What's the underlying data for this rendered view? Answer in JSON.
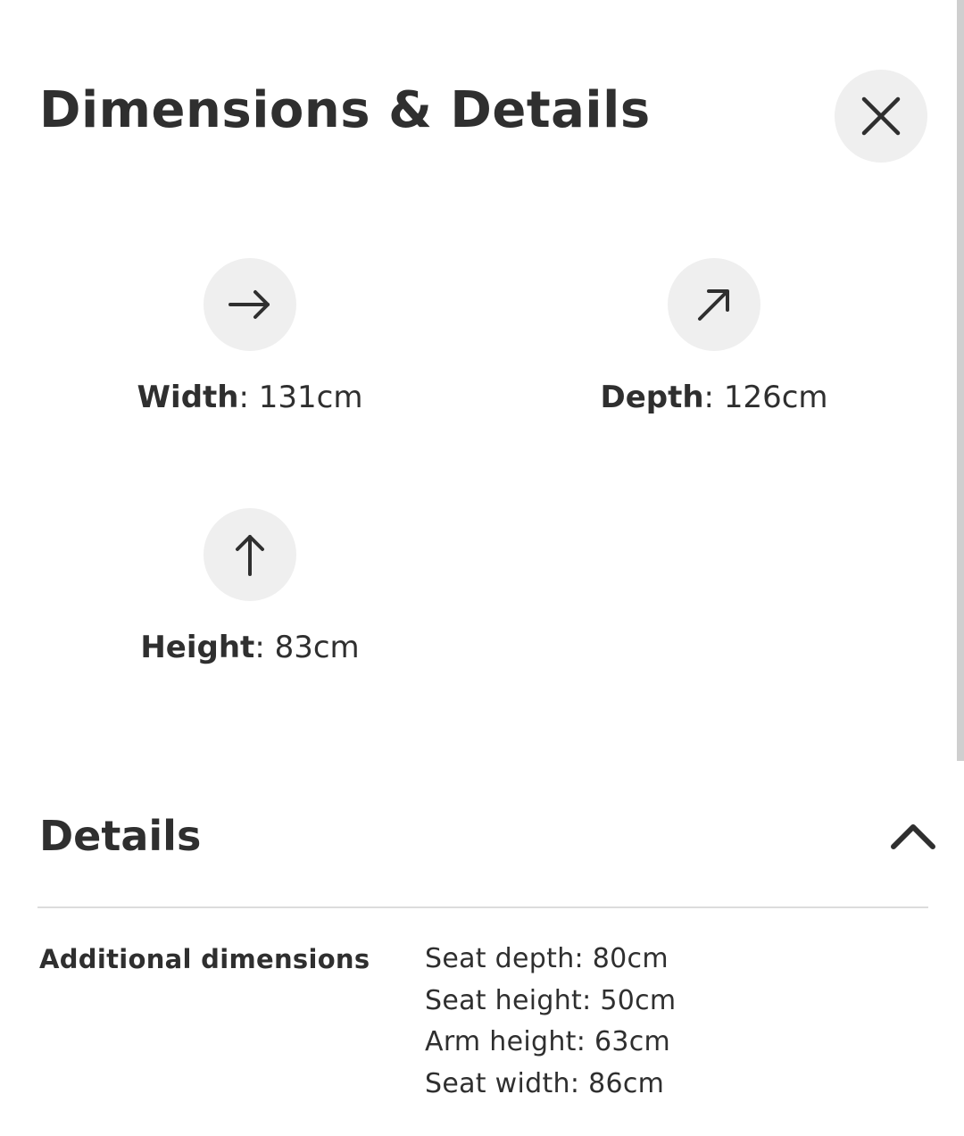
{
  "header": {
    "title": "Dimensions & Details",
    "close_icon": "close-icon"
  },
  "dimensions": [
    {
      "label": "Width",
      "separator": ": ",
      "value": "131cm",
      "icon": "arrow-right-icon"
    },
    {
      "label": "Depth",
      "separator": ": ",
      "value": "126cm",
      "icon": "arrow-up-right-icon"
    },
    {
      "label": "Height",
      "separator": ": ",
      "value": "83cm",
      "icon": "arrow-up-icon"
    }
  ],
  "details": {
    "title": "Details",
    "toggle_icon": "chevron-up-icon",
    "expanded": true,
    "additional_dimensions": {
      "label": "Additional dimensions",
      "items": [
        "Seat depth: 80cm",
        "Seat height: 50cm",
        "Arm height: 63cm",
        "Seat width: 86cm"
      ]
    }
  },
  "colors": {
    "text": "#2f2f2f",
    "icon_bg": "#efefef",
    "divider": "#dcdcdc",
    "background": "#ffffff"
  }
}
